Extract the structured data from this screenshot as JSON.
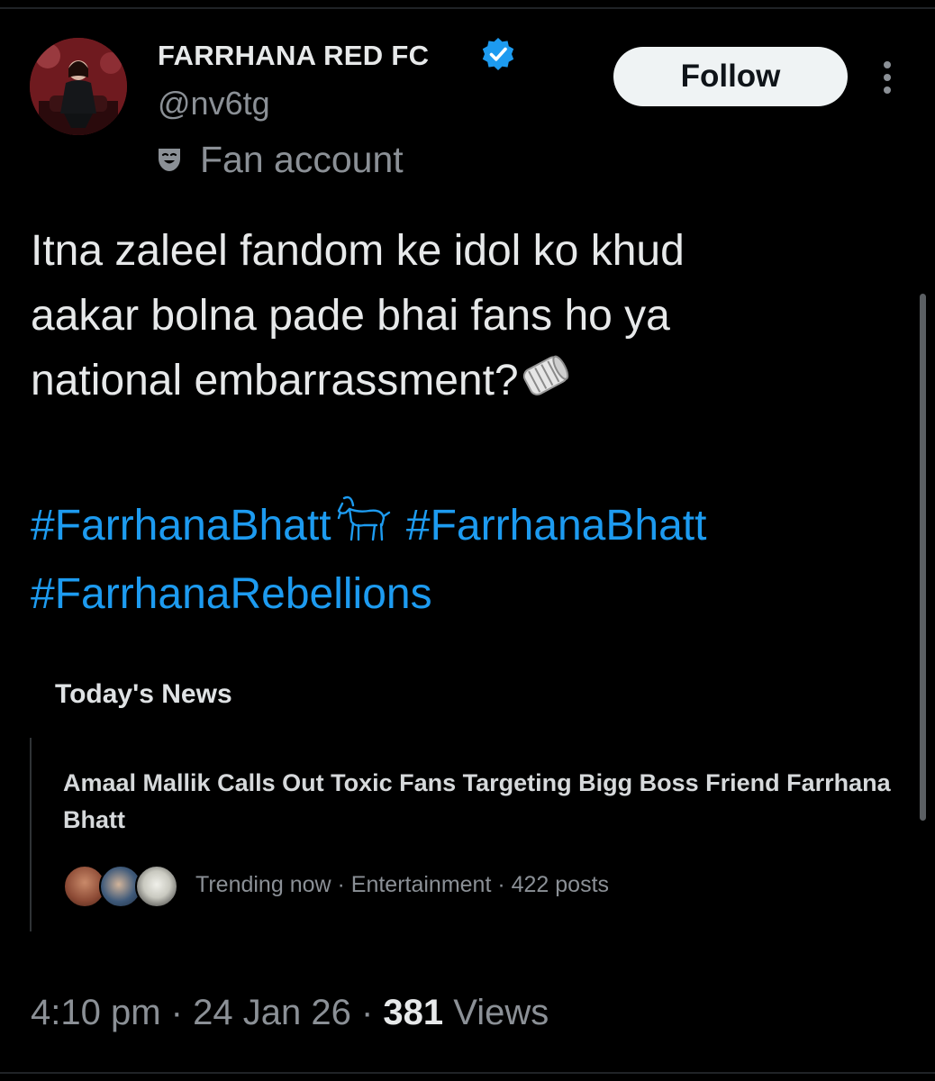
{
  "author": {
    "display_name": "FARRHANA RED FC",
    "handle": "@nv6tg",
    "verified": true,
    "account_label": "Fan account",
    "label_icon": "theater-masks-icon"
  },
  "actions": {
    "follow_label": "Follow",
    "more_icon": "more-vertical-icon"
  },
  "tweet": {
    "text_lines": [
      "Itna zaleel fandom ke idol ko khud",
      "aakar bolna pade  bhai fans ho ya",
      "national embarrassment?"
    ],
    "inline_emoji": "rolled-up-newspaper-emoji",
    "hashtags": [
      "#FarrhanaBhatt",
      "#FarrhanaBhatt",
      "#FarrhanaRebellions"
    ],
    "hashtag_emoji": "goat-emoji"
  },
  "news": {
    "section_title": "Today's News",
    "headline": "Amaal Mallik Calls Out Toxic Fans Targeting Bigg Boss Friend Farrhana Bhatt",
    "meta": "Trending now · Entertainment · 422 posts"
  },
  "footer": {
    "time": "4:10 pm",
    "date": "24 Jan 26",
    "separator": "·",
    "views_count": "381",
    "views_label": "Views"
  },
  "colors": {
    "background": "#000000",
    "text_primary": "#e7e9ea",
    "text_secondary": "#8b9096",
    "hashtag": "#1d9bf0",
    "verified_badge": "#1d9bf0",
    "follow_button_bg": "#eff3f4"
  }
}
